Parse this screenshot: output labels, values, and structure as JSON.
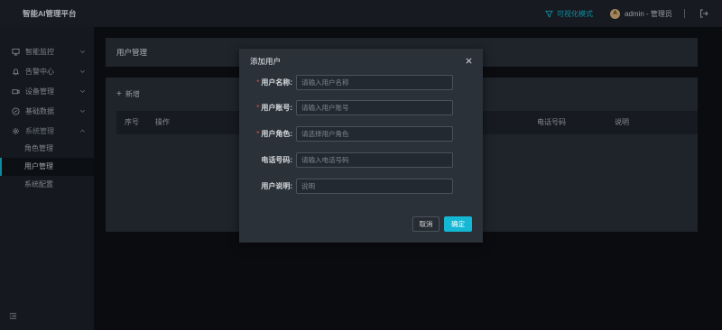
{
  "app": {
    "title": "智能AI管理平台",
    "accent_color": "#14b8d4"
  },
  "topbar": {
    "viz_mode_label": "可视化模式",
    "viz_mode_icon": "funnel-icon",
    "avatar_letter": "A",
    "user_label": "admin - 管理员",
    "logout_icon": "logout-icon"
  },
  "sidebar": {
    "items": [
      {
        "label": "智能监控",
        "icon": "monitor-icon"
      },
      {
        "label": "告警中心",
        "icon": "bell-icon"
      },
      {
        "label": "设备管理",
        "icon": "camera-icon"
      },
      {
        "label": "基础数据",
        "icon": "compass-icon"
      },
      {
        "label": "系统管理",
        "icon": "gear-icon",
        "expanded": true
      }
    ],
    "sub_items": [
      {
        "label": "角色管理"
      },
      {
        "label": "用户管理",
        "selected": true
      },
      {
        "label": "系统配置"
      }
    ],
    "collapse_icon": "collapse-menu-icon"
  },
  "main": {
    "page_title": "用户管理",
    "add_button": {
      "plus": "+",
      "label": "新增"
    },
    "table": {
      "headers": [
        "序号",
        "操作",
        "电话号码",
        "说明"
      ]
    }
  },
  "modal": {
    "title": "添加用户",
    "fields": [
      {
        "label": "用户名称:",
        "required": true,
        "placeholder": "请输入用户名称"
      },
      {
        "label": "用户账号:",
        "required": true,
        "placeholder": "请输入用户账号"
      },
      {
        "label": "用户角色:",
        "required": true,
        "placeholder": "请选择用户角色"
      },
      {
        "label": "电话号码:",
        "required": false,
        "placeholder": "请输入电话号码"
      },
      {
        "label": "用户说明:",
        "required": false,
        "placeholder": "说明"
      }
    ],
    "required_mark": "*",
    "cancel_label": "取消",
    "ok_label": "确定"
  }
}
